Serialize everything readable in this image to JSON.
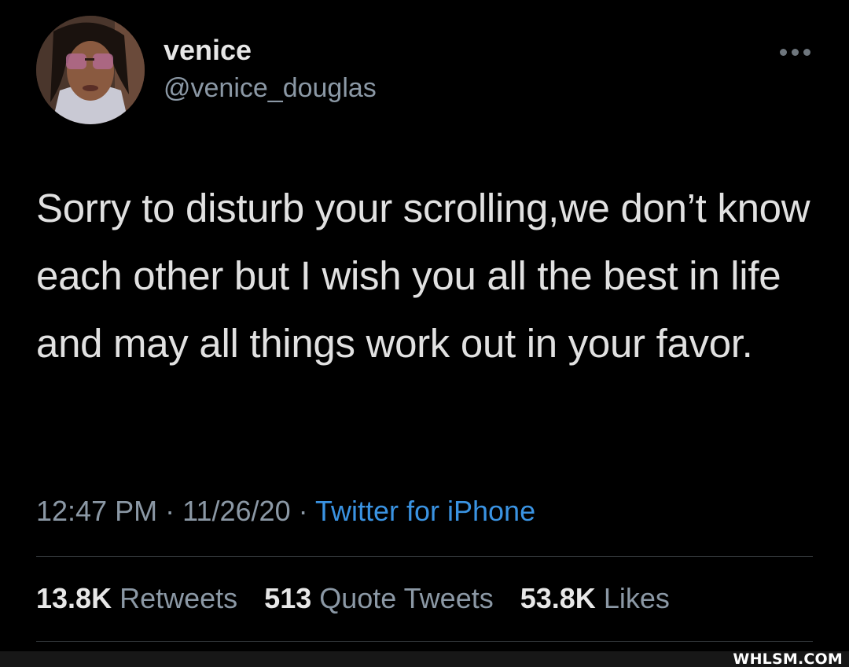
{
  "user": {
    "display_name": "venice",
    "handle": "@venice_douglas"
  },
  "tweet": {
    "text": "Sorry to disturb your scrolling,we don’t know each other but I wish you all the best in life and may all things work out in your favor.",
    "time": "12:47 PM",
    "date": "11/26/20",
    "separator": "·",
    "source": "Twitter for iPhone"
  },
  "stats": [
    {
      "count": "13.8K",
      "label": "Retweets"
    },
    {
      "count": "513",
      "label": "Quote Tweets"
    },
    {
      "count": "53.8K",
      "label": "Likes"
    }
  ],
  "watermark": "WHLSM.COM",
  "colors": {
    "background": "#000000",
    "link": "#3a93e2",
    "secondary_text": "#8b98a5"
  },
  "icons": {
    "more": "more-horizontal-icon"
  }
}
